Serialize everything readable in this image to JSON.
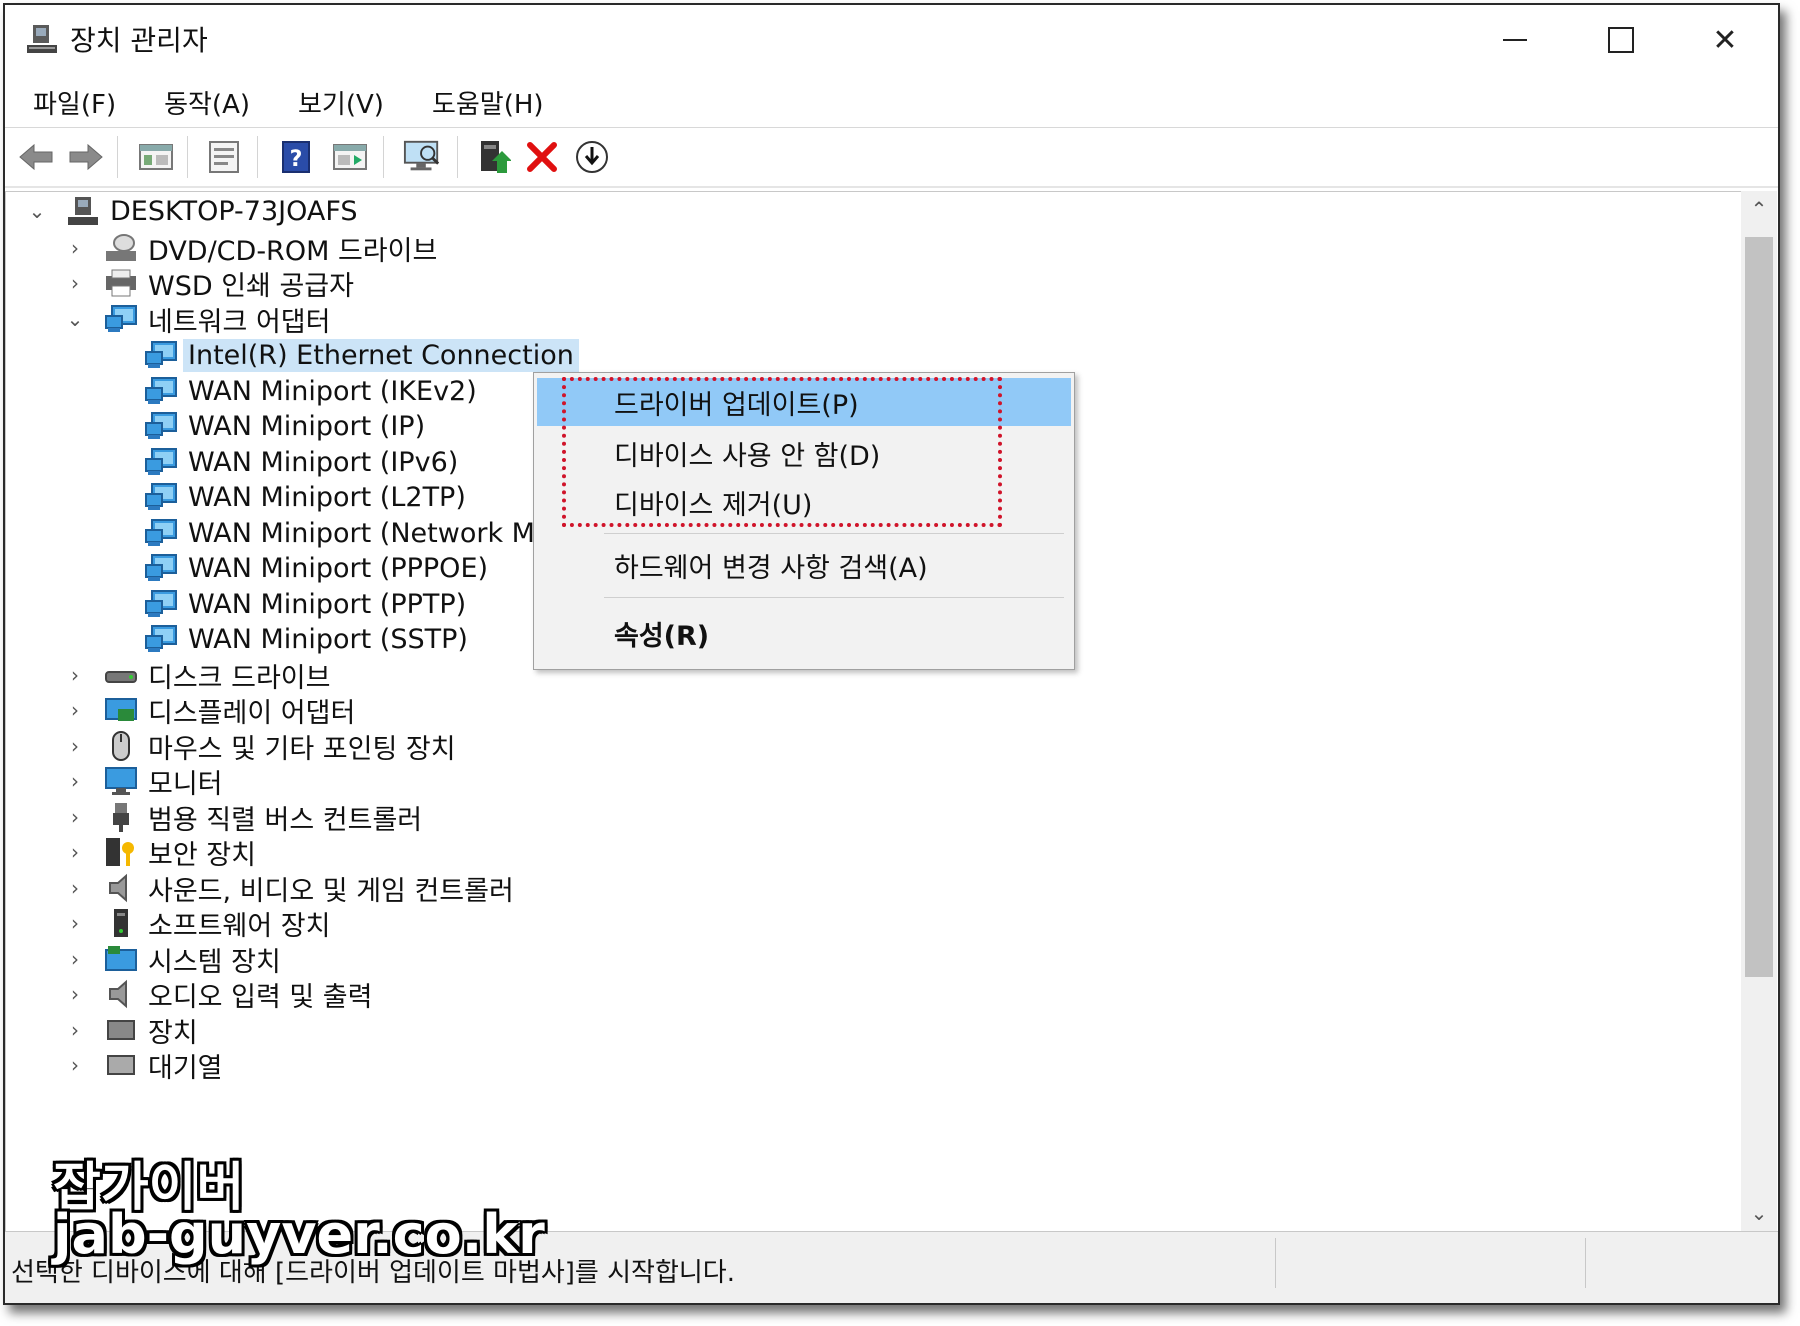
{
  "window": {
    "title": "장치 관리자",
    "title_icon": "device-manager-icon",
    "minimize_icon": "minimize-icon",
    "maximize_icon": "maximize-icon",
    "close_icon": "close-icon",
    "close_glyph": "✕"
  },
  "menu": [
    "파일(F)",
    "동작(A)",
    "보기(V)",
    "도움말(H)"
  ],
  "toolbar": [
    {
      "icon": "back-arrow-icon"
    },
    {
      "icon": "forward-arrow-icon"
    },
    {
      "icon": "show-hide-console-tree-icon"
    },
    {
      "icon": "properties-icon"
    },
    {
      "icon": "help-icon"
    },
    {
      "icon": "action-pane-icon"
    },
    {
      "icon": "scan-hardware-icon"
    },
    {
      "icon": "update-driver-icon"
    },
    {
      "icon": "uninstall-device-icon"
    },
    {
      "icon": "download-driver-icon"
    }
  ],
  "tree": {
    "root": {
      "label": "DESKTOP-73JOAFS",
      "chevron": "⌄",
      "icon": "computer-icon"
    },
    "groups_before": [
      {
        "label": "DVD/CD-ROM 드라이브",
        "chevron": "›",
        "icon": "dvd-drive-icon"
      },
      {
        "label": "WSD 인쇄 공급자",
        "chevron": "›",
        "icon": "printer-icon"
      },
      {
        "label": "네트워크 어댑터",
        "chevron": "⌄",
        "icon": "network-adapter-icon"
      }
    ],
    "network_children": [
      "Intel(R) Ethernet Connection",
      "WAN Miniport (IKEv2)",
      "WAN Miniport (IP)",
      "WAN Miniport (IPv6)",
      "WAN Miniport (L2TP)",
      "WAN Miniport (Network Mc",
      "WAN Miniport (PPPOE)",
      "WAN Miniport (PPTP)",
      "WAN Miniport (SSTP)"
    ],
    "groups_after": [
      {
        "label": "디스크 드라이브",
        "chevron": "›",
        "icon": "disk-drive-icon"
      },
      {
        "label": "디스플레이 어댑터",
        "chevron": "›",
        "icon": "display-adapter-icon"
      },
      {
        "label": "마우스 및 기타 포인팅 장치",
        "chevron": "›",
        "icon": "mouse-icon"
      },
      {
        "label": "모니터",
        "chevron": "›",
        "icon": "monitor-icon"
      },
      {
        "label": "범용 직렬 버스 컨트롤러",
        "chevron": "›",
        "icon": "usb-icon"
      },
      {
        "label": "보안 장치",
        "chevron": "›",
        "icon": "security-device-icon"
      },
      {
        "label": "사운드, 비디오 및 게임 컨트롤러",
        "chevron": "›",
        "icon": "speaker-icon"
      },
      {
        "label": "소프트웨어 장치",
        "chevron": "›",
        "icon": "software-device-icon"
      },
      {
        "label": "시스템 장치",
        "chevron": "›",
        "icon": "system-device-icon"
      },
      {
        "label": "오디오 입력 및 출력",
        "chevron": "›",
        "icon": "audio-io-icon"
      },
      {
        "label": "장치",
        "chevron": "›",
        "icon": "generic-device-icon"
      },
      {
        "label": "대기열",
        "chevron": "›",
        "icon": "queue-icon"
      }
    ]
  },
  "context_menu": [
    {
      "label": "드라이버 업데이트(P)",
      "highlighted": true,
      "bold": false
    },
    {
      "label": "디바이스 사용 안 함(D)",
      "highlighted": false,
      "bold": false
    },
    {
      "label": "디바이스 제거(U)",
      "highlighted": false,
      "bold": false
    },
    {
      "separator": true
    },
    {
      "label": "하드웨어 변경 사항 검색(A)",
      "highlighted": false,
      "bold": false
    },
    {
      "separator": true
    },
    {
      "label": "속성(R)",
      "highlighted": false,
      "bold": true
    }
  ],
  "scrollbar": {
    "up": "⌃",
    "down": "⌄"
  },
  "status": {
    "text": "선택한 디바이스에 대해 [드라이버 업데이트 마법사]를 시작합니다."
  },
  "watermark": {
    "line1": "잡가이버",
    "line2": "jab-guyver.co.kr"
  },
  "colors": {
    "selection": "#cce4f7",
    "menu_highlight": "#91c9f7",
    "annotation_box": "#d0142a",
    "network_icon": "#2a8ad8",
    "uninstall_x": "#e01010"
  }
}
